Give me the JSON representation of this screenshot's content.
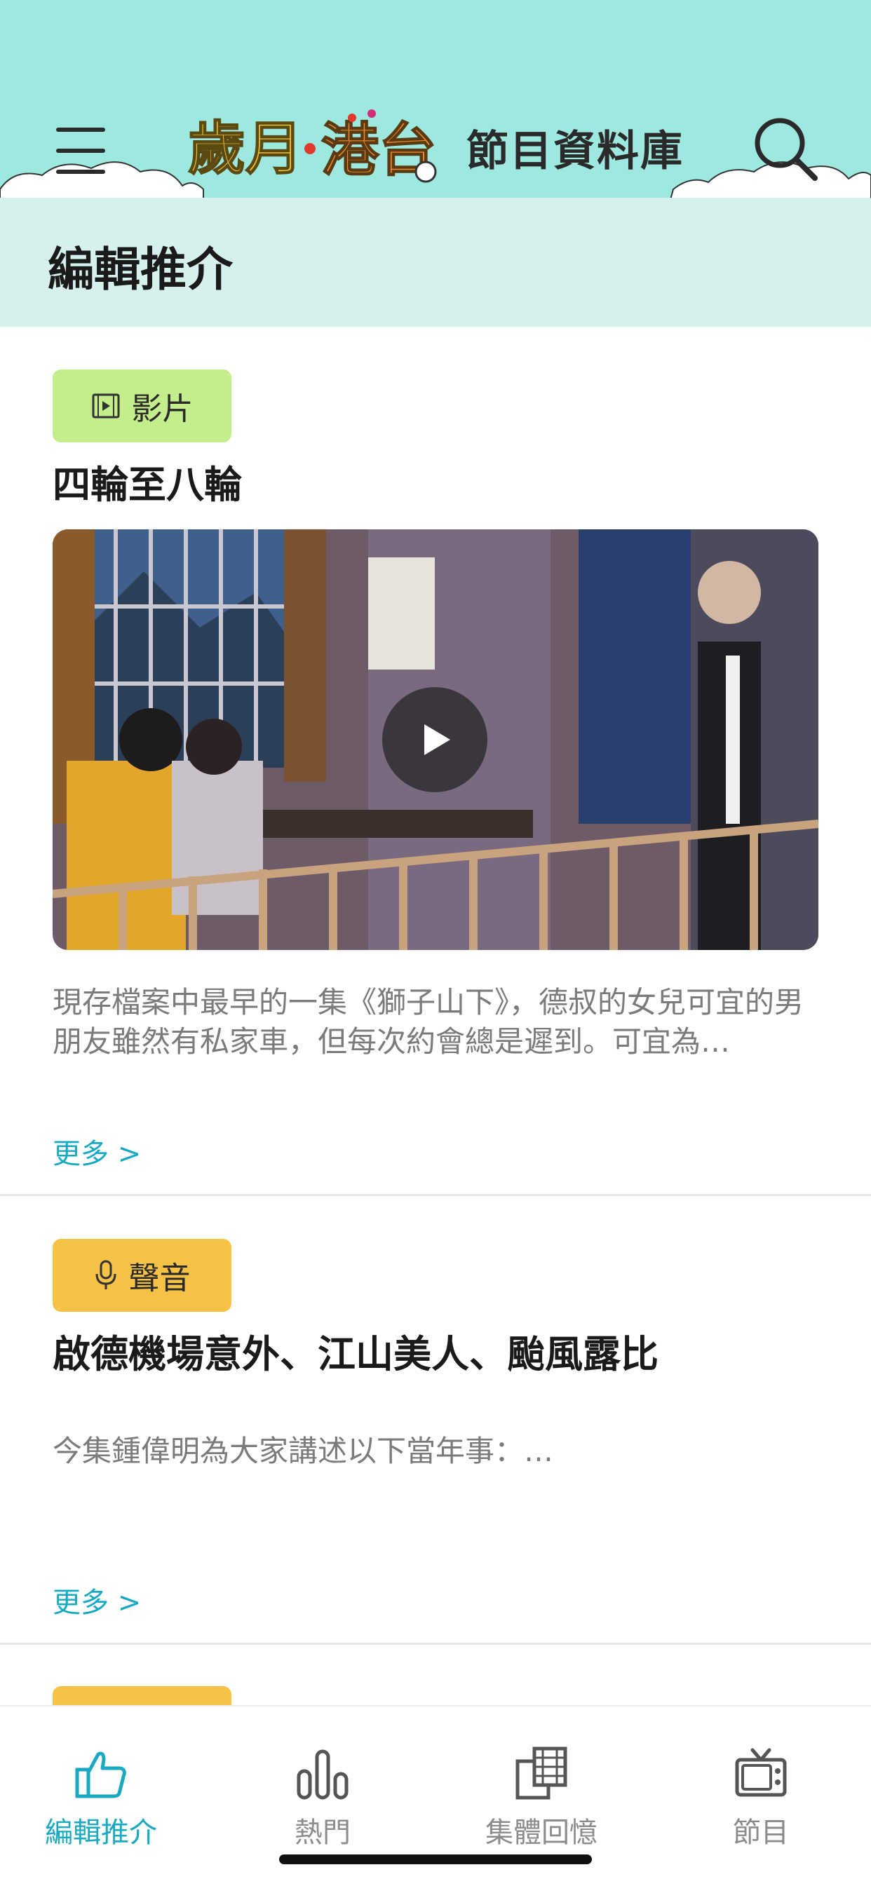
{
  "header": {
    "logo_text": "歲月·港台",
    "title": "節目資料庫",
    "menu_icon": "hamburger-menu-icon",
    "search_icon": "search-icon",
    "background": "#9ee9df"
  },
  "section": {
    "title": "編輯推介"
  },
  "cards": [
    {
      "badge": {
        "label": "影片",
        "icon": "video-icon",
        "color": "#c4ee8b"
      },
      "title": "四輪至八輪",
      "has_video": true,
      "description": "現存檔案中最早的一集《獅子山下》，德叔的女兒可宜的男朋友雖然有私家車，但每次約會總是遲到。可宜為…",
      "more": "更多 >"
    },
    {
      "badge": {
        "label": "聲音",
        "icon": "microphone-icon",
        "color": "#f6c245"
      },
      "title": "啟德機場意外、江山美人、颱風露比",
      "has_video": false,
      "description": "今集鍾偉明為大家講述以下當年事：…",
      "more": "更多 >"
    }
  ],
  "tabbar": {
    "active_color": "#19a9c2",
    "items": [
      {
        "label": "編輯推介",
        "icon": "thumbs-up-icon",
        "active": true
      },
      {
        "label": "熱門",
        "icon": "bar-chart-icon",
        "active": false
      },
      {
        "label": "集體回憶",
        "icon": "film-strip-icon",
        "active": false
      },
      {
        "label": "節目",
        "icon": "tv-icon",
        "active": false
      }
    ]
  }
}
